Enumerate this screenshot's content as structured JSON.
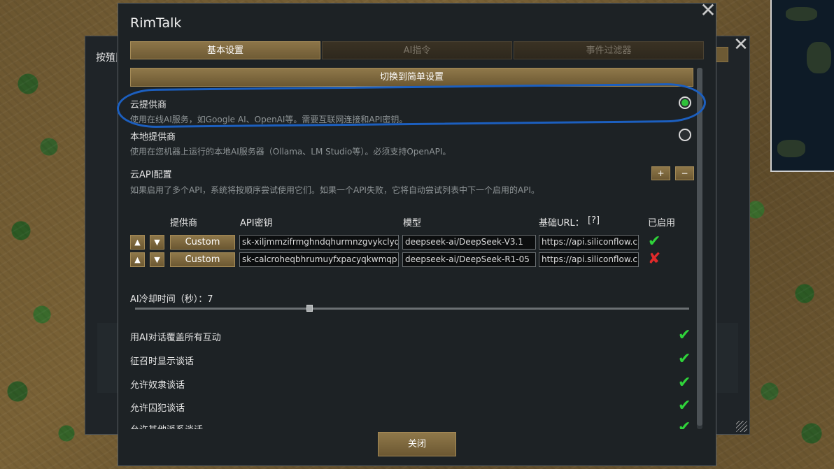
{
  "background_dialog": {
    "title_fragment": "按殖民"
  },
  "dialog": {
    "title": "RimTalk",
    "close_glyph": "✕",
    "tabs": [
      {
        "label": "基本设置",
        "active": true
      },
      {
        "label": "AI指令",
        "active": false
      },
      {
        "label": "事件过滤器",
        "active": false
      }
    ],
    "switch_button": "切换到简单设置",
    "providers": {
      "cloud": {
        "title": "云提供商",
        "desc": "使用在线AI服务，如Google AI、OpenAI等。需要互联网连接和API密钥。",
        "selected": true
      },
      "local": {
        "title": "本地提供商",
        "desc": "使用在您机器上运行的本地AI服务器（Ollama、LM Studio等）。必须支持OpenAPI。",
        "selected": false
      }
    },
    "api_config": {
      "title": "云API配置",
      "desc": "如果启用了多个API，系统将按顺序尝试使用它们。如果一个API失败，它将自动尝试列表中下一个启用的API。",
      "add_label": "+",
      "remove_label": "−",
      "columns": {
        "provider": "提供商",
        "api_key": "API密钥",
        "model": "模型",
        "base_url": "基础URL：",
        "help": "[?]",
        "enabled": "已启用"
      },
      "up_glyph": "▲",
      "down_glyph": "▼",
      "rows": [
        {
          "provider": "Custom",
          "api_key": "sk-xiljmmzifrmghndqhurmnzgvykclyq",
          "model": "deepseek-ai/DeepSeek-V3.1",
          "base_url": "https://api.siliconflow.cn",
          "enabled": true,
          "status_glyph": "✔"
        },
        {
          "provider": "Custom",
          "api_key": "sk-calcroheqbhrumuyfxpacyqkwmqp",
          "model": "deepseek-ai/DeepSeek-R1-05",
          "base_url": "https://api.siliconflow.cn",
          "enabled": false,
          "status_glyph": "✘"
        }
      ]
    },
    "cooldown": {
      "label": "AI冷却时间（秒）：7",
      "value": 7,
      "fraction": 0.315
    },
    "toggles": [
      {
        "label": "用AI对话覆盖所有互动",
        "checked": true
      },
      {
        "label": "征召时显示谈话",
        "checked": true
      },
      {
        "label": "允许奴隶谈话",
        "checked": true
      },
      {
        "label": "允许囚犯谈话",
        "checked": true
      },
      {
        "label": "允许其他派系谈话",
        "checked": true
      }
    ],
    "check_glyph": "✔",
    "close_button": "关闭"
  },
  "colors": {
    "accent_gold": "#8f784a",
    "enabled_green": "#2fd33a",
    "disabled_red": "#e02a2a",
    "annotation_blue": "#1c5fbf"
  }
}
